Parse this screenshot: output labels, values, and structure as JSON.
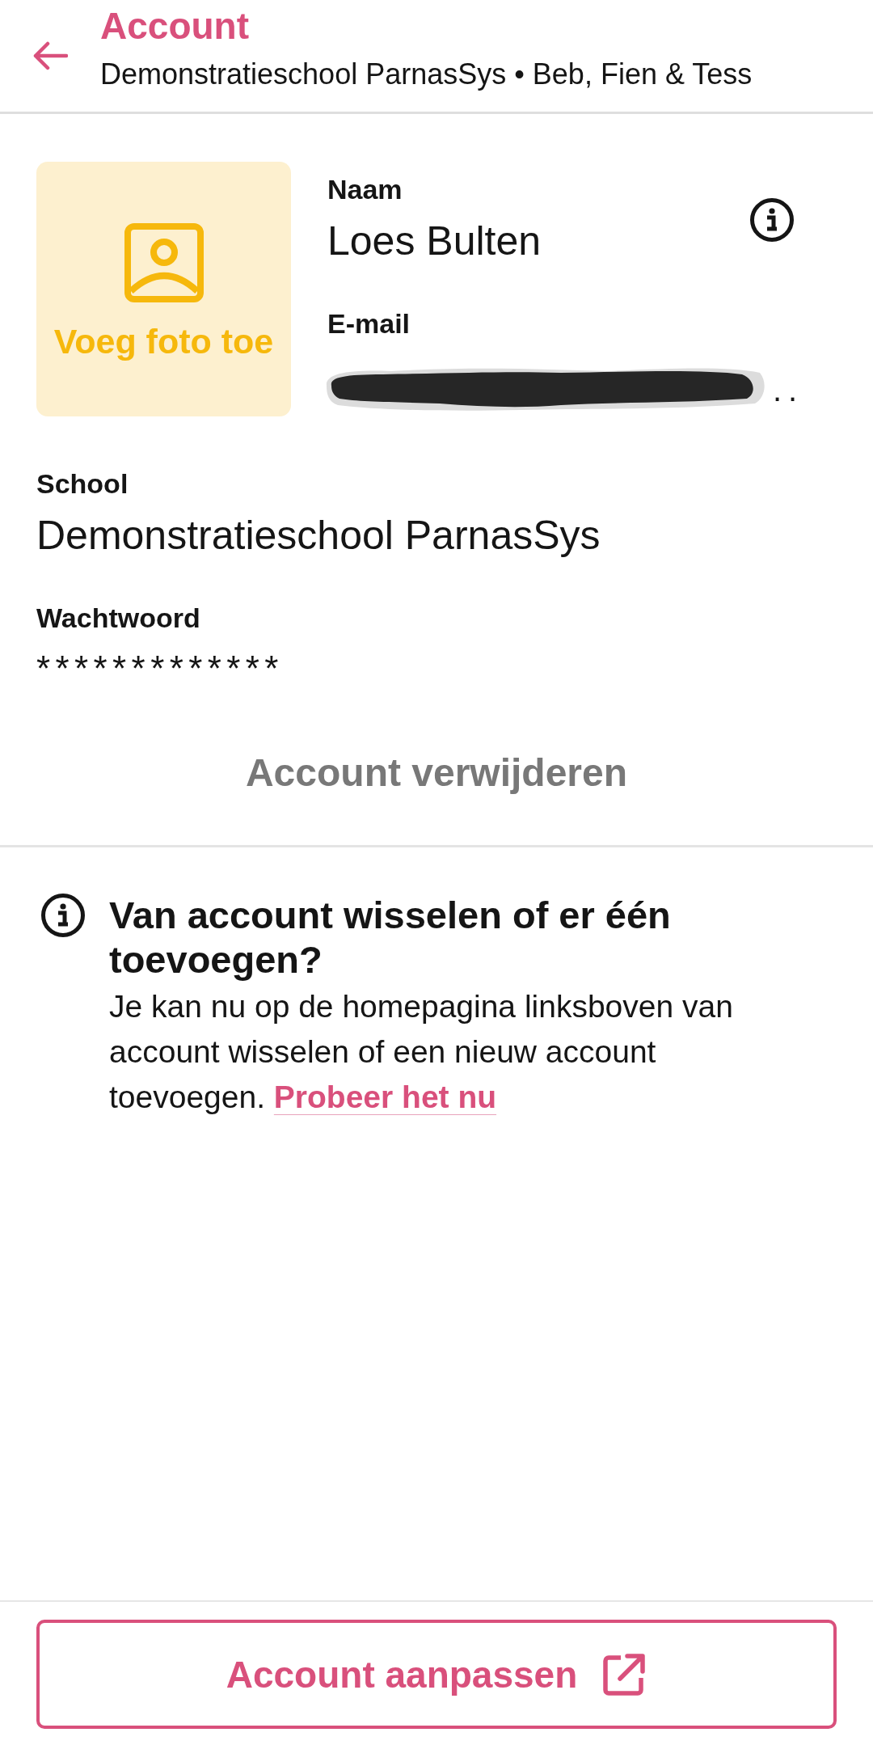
{
  "header": {
    "title": "Account",
    "subtitle": "Demonstratieschool ParnasSys • Beb, Fien & Tess"
  },
  "profile": {
    "photo_button": "Voeg foto toe",
    "name": {
      "label": "Naam",
      "value": "Loes Bulten"
    },
    "email": {
      "label": "E-mail",
      "value": "..",
      "redacted": true
    }
  },
  "details": [
    {
      "label": "School",
      "value": "Demonstratieschool ParnasSys"
    },
    {
      "label": "Wachtwoord",
      "value": "*************"
    }
  ],
  "delete_button": "Account verwijderen",
  "info": {
    "title": "Van account wisselen of er één toevoegen?",
    "body": "Je kan nu op de homepagina linksboven van account wisselen of een nieuw account toevoegen.",
    "link": "Probeer het nu"
  },
  "footer_button": "Account aanpassen"
}
